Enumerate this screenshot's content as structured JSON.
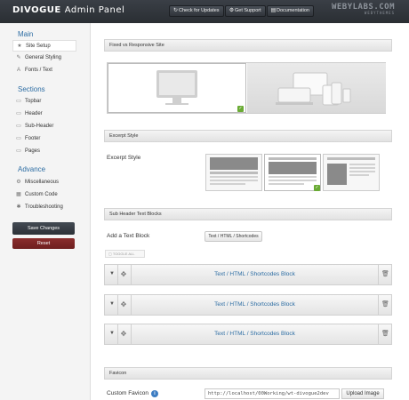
{
  "header": {
    "brand": "DIVOGUE",
    "subtitle": "Admin Panel",
    "buttons": [
      {
        "label": "Check for Updates",
        "icon": "refresh-icon"
      },
      {
        "label": "Get Support",
        "icon": "gear-icon"
      },
      {
        "label": "Documentation",
        "icon": "book-icon"
      }
    ],
    "watermark": "WEBYLABS.COM",
    "watermark_sub": "WEBYTHEMES"
  },
  "sidebar": {
    "main_title": "Main",
    "main_items": [
      {
        "label": "Site Setup",
        "icon": "star-icon",
        "active": true
      },
      {
        "label": "General Styling",
        "icon": "brush-icon"
      },
      {
        "label": "Fonts / Text",
        "icon": "font-icon"
      }
    ],
    "sections_title": "Sections",
    "section_items": [
      {
        "label": "Topbar",
        "icon": "page-icon"
      },
      {
        "label": "Header",
        "icon": "page-icon"
      },
      {
        "label": "Sub-Header",
        "icon": "page-icon"
      },
      {
        "label": "Footer",
        "icon": "page-icon"
      },
      {
        "label": "Pages",
        "icon": "page-icon"
      }
    ],
    "advance_title": "Advance",
    "advance_items": [
      {
        "label": "Miscellaneous",
        "icon": "gear-icon"
      },
      {
        "label": "Custom Code",
        "icon": "code-icon"
      },
      {
        "label": "Troubleshooting",
        "icon": "wrench-icon"
      }
    ],
    "save_label": "Save Changes",
    "reset_label": "Reset"
  },
  "main": {
    "layout_section": "Fixed vs Responsive Site",
    "excerpt_section": "Excerpt Style",
    "excerpt_label": "Excerpt Style",
    "subheader_section": "Sub Header Text Blocks",
    "add_block_label": "Add a Text Block",
    "add_block_button": "Text / HTML / Shortcodes",
    "toggle_all": "TOGGLE ALL",
    "blocks": [
      "Text / HTML / Shortcodes Block",
      "Text / HTML / Shortcodes Block",
      "Text / HTML / Shortcodes Block"
    ],
    "favicon_section": "Favicon",
    "favicon_label": "Custom Favicon",
    "favicon_url": "http://localhost/00Working/wt-divogue2dev",
    "upload_label": "Upload Image"
  },
  "colors": {
    "accent_blue": "#2d6da3",
    "check_green": "#6aab34",
    "reset_red": "#7a2424",
    "header_dark": "#2f3338"
  }
}
